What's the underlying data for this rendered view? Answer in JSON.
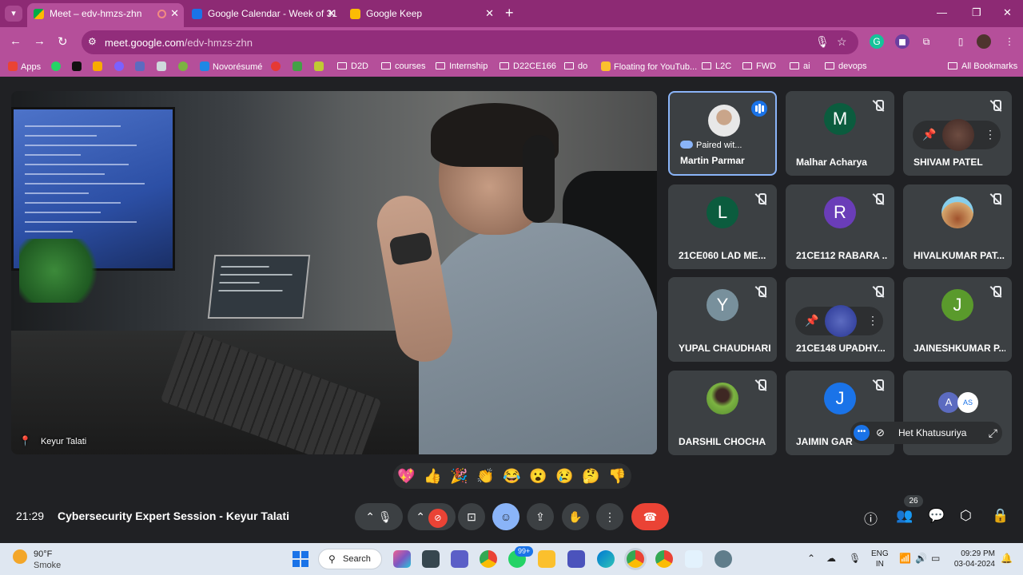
{
  "browser": {
    "tabs": [
      {
        "title": "Meet – edv-hmzs-zhn",
        "active": true
      },
      {
        "title": "Google Calendar - Week of 31 I",
        "active": false
      },
      {
        "title": "Google Keep",
        "active": false
      }
    ],
    "url_host": "meet.google.com",
    "url_path": "/edv-hmzs-zhn",
    "bookmarks": [
      {
        "label": "Apps",
        "type": "apps"
      },
      {
        "label": "Novorésumé",
        "type": "link"
      },
      {
        "label": "D2D",
        "type": "folder"
      },
      {
        "label": "courses",
        "type": "folder"
      },
      {
        "label": "Internship",
        "type": "folder"
      },
      {
        "label": "D22CE166",
        "type": "folder"
      },
      {
        "label": "do",
        "type": "folder"
      },
      {
        "label": "Floating for YouTub...",
        "type": "link"
      },
      {
        "label": "L2C",
        "type": "folder"
      },
      {
        "label": "FWD",
        "type": "folder"
      },
      {
        "label": "ai",
        "type": "folder"
      },
      {
        "label": "devops",
        "type": "folder"
      }
    ],
    "all_bookmarks": "All Bookmarks"
  },
  "meet": {
    "main_speaker": "Keyur Talati",
    "participants": [
      {
        "name": "Martin Parmar",
        "status": "Paired wit...",
        "speaking": true
      },
      {
        "name": "Malhar Acharya",
        "initial": "M",
        "color": "#0b5c3e"
      },
      {
        "name": "SHIVAM PATEL"
      },
      {
        "name": "21CE060 LAD ME...",
        "initial": "L",
        "color": "#0b5c3e"
      },
      {
        "name": "21CE112 RABARA ...",
        "initial": "R",
        "color": "#6a3db8"
      },
      {
        "name": "HIVALKUMAR PAT..."
      },
      {
        "name": "YUPAL CHAUDHARI",
        "initial": "Y",
        "color": "#78909c"
      },
      {
        "name": "21CE148 UPADHY..."
      },
      {
        "name": "JAINESHKUMAR P...",
        "initial": "J",
        "color": "#5a9a2c"
      },
      {
        "name": "DARSHIL CHOCHA"
      },
      {
        "name": "JAIMIN GAR",
        "initial": "J",
        "color": "#1a73e8"
      },
      {
        "name": "",
        "initials": [
          "A",
          "AS"
        ]
      }
    ],
    "floating_name": "Het Khatusuriya",
    "reactions": [
      "💖",
      "👍",
      "🎉",
      "👏",
      "😂",
      "😮",
      "😢",
      "🤔",
      "👎"
    ],
    "time": "21:29",
    "meeting_title": "Cybersecurity Expert Session - Keyur Talati",
    "people_count": "26"
  },
  "taskbar": {
    "temp": "90°F",
    "weather": "Smoke",
    "search": "Search",
    "notif_badge": "99+",
    "lang_top": "ENG",
    "lang_bottom": "IN",
    "time": "09:29 PM",
    "date": "03-04-2024"
  }
}
